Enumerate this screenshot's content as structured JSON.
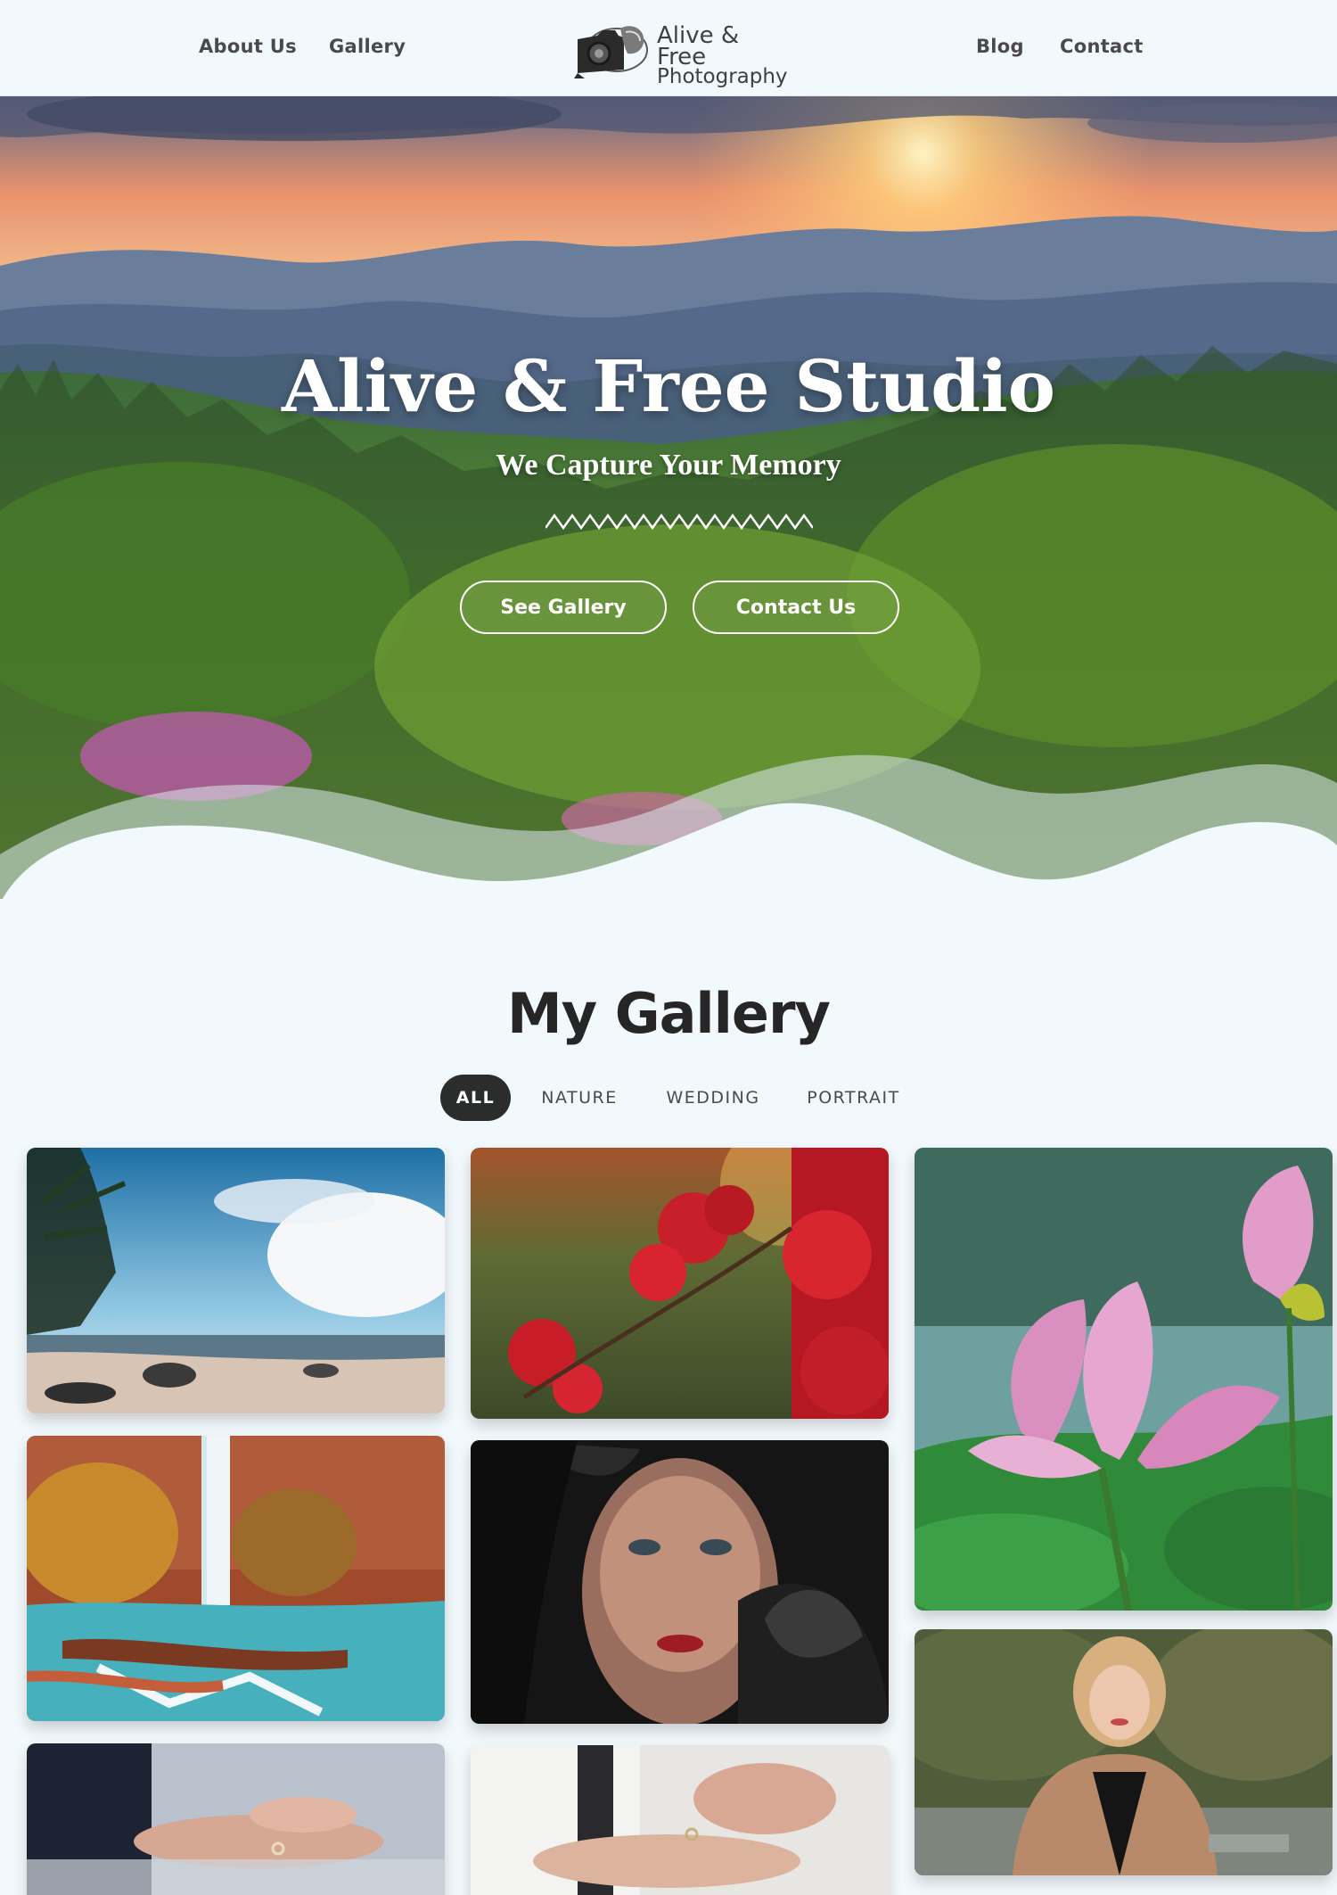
{
  "nav": {
    "left_links": [
      "About Us",
      "Gallery"
    ],
    "right_links": [
      "Blog",
      "Contact"
    ],
    "logo": {
      "line1": "Alive & Free",
      "line2": "Photography",
      "icon": "camera-logo-icon"
    }
  },
  "hero": {
    "title": "Alive & Free Studio",
    "subtitle": "We Capture Your Memory",
    "buttons": [
      "See Gallery",
      "Contact Us"
    ]
  },
  "gallery": {
    "title": "My Gallery",
    "filters": [
      "ALL",
      "NATURE",
      "WEDDING",
      "PORTRAIT"
    ],
    "active_filter": "ALL"
  },
  "colors": {
    "background": "#f2f9fd",
    "text_dark": "#262626",
    "active_filter_bg": "#2b2d2c"
  }
}
